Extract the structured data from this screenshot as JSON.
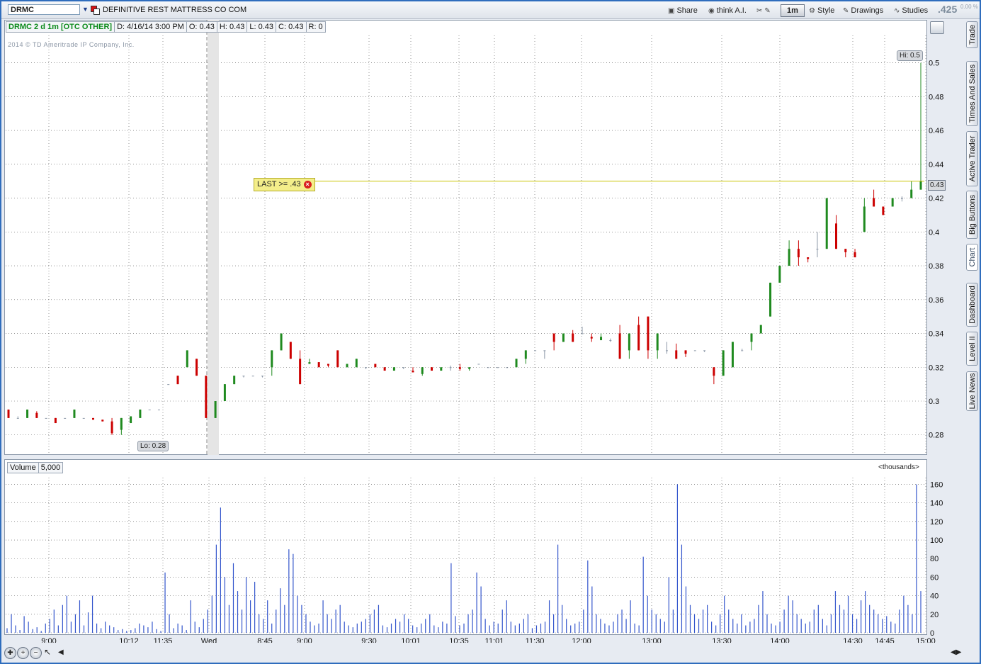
{
  "toolbar": {
    "symbol": "DRMC",
    "description": "DEFINITIVE REST MATTRESS CO COM",
    "share_label": "Share",
    "thinkai_label": "think A.I.",
    "aggregation_label": "1m",
    "style_label": "Style",
    "drawings_label": "Drawings",
    "studies_label": "Studies",
    "last_price": ".425",
    "percent_change": "0.00 %"
  },
  "info_bar": {
    "title": "DRMC 2 d 1m [OTC OTHER]",
    "date": "D: 4/16/14 3:00 PM",
    "open": "O: 0.43",
    "high": "H: 0.43",
    "low": "L: 0.43",
    "close": "C: 0.43",
    "range": "R: 0"
  },
  "copyright": "2014 © TD Ameritrade IP Company, Inc.",
  "alert": {
    "label": "LAST >= .43",
    "level": 0.43
  },
  "hi_label": "Hi: 0.5",
  "lo_label": "Lo: 0.28",
  "current_price_tag": "0.43",
  "volume_panel": {
    "label": "Volume",
    "value": "5,000",
    "units": "<thousands>"
  },
  "side_tabs": [
    "Trade",
    "Times And Sales",
    "Active Trader",
    "Big Buttons",
    "Chart",
    "Dashboard",
    "Level II",
    "Live News"
  ],
  "colors": {
    "up": "#1f8a1f",
    "down": "#cc0000",
    "flat": "#8a96a6",
    "volume": "#3355cc",
    "alert_line": "#c8c200",
    "alert_fill": "#f4ee8a"
  },
  "chart_data": [
    {
      "type": "candlestick",
      "title": "DRMC 2 d 1m [OTC OTHER]",
      "y_ticks": [
        0.28,
        0.3,
        0.32,
        0.34,
        0.36,
        0.38,
        0.4,
        0.42,
        0.44,
        0.46,
        0.48,
        0.5
      ],
      "y_tick_labels": [
        "0.28",
        "0.3",
        "0.32",
        "0.34",
        "0.36",
        "0.38",
        "0.4",
        "0.42",
        "0.44",
        "0.46",
        "0.48",
        "0.5"
      ],
      "ylim": [
        0.269,
        0.517
      ],
      "x_ticks": [
        "9:00",
        "10:12",
        "11:35",
        "Wed",
        "8:45",
        "9:00",
        "9:30",
        "10:01",
        "10:35",
        "11:01",
        "11:30",
        "12:00",
        "13:00",
        "13:30",
        "14:00",
        "14:30",
        "14:45",
        "15:00"
      ],
      "grid": true,
      "ohlc": [
        {
          "o": 0.295,
          "h": 0.295,
          "l": 0.29,
          "c": 0.29
        },
        {
          "o": 0.29,
          "h": 0.291,
          "l": 0.29,
          "c": 0.29
        },
        {
          "o": 0.29,
          "h": 0.295,
          "l": 0.29,
          "c": 0.295
        },
        {
          "o": 0.293,
          "h": 0.294,
          "l": 0.29,
          "c": 0.29
        },
        {
          "o": 0.29,
          "h": 0.29,
          "l": 0.29,
          "c": 0.29
        },
        {
          "o": 0.29,
          "h": 0.29,
          "l": 0.287,
          "c": 0.287
        },
        {
          "o": 0.29,
          "h": 0.29,
          "l": 0.29,
          "c": 0.29
        },
        {
          "o": 0.29,
          "h": 0.295,
          "l": 0.29,
          "c": 0.295
        },
        {
          "o": 0.29,
          "h": 0.29,
          "l": 0.29,
          "c": 0.29
        },
        {
          "o": 0.29,
          "h": 0.29,
          "l": 0.289,
          "c": 0.289
        },
        {
          "o": 0.289,
          "h": 0.289,
          "l": 0.288,
          "c": 0.288
        },
        {
          "o": 0.288,
          "h": 0.29,
          "l": 0.28,
          "c": 0.281
        },
        {
          "o": 0.283,
          "h": 0.29,
          "l": 0.28,
          "c": 0.29
        },
        {
          "o": 0.287,
          "h": 0.291,
          "l": 0.287,
          "c": 0.291
        },
        {
          "o": 0.29,
          "h": 0.295,
          "l": 0.29,
          "c": 0.295
        },
        {
          "o": 0.295,
          "h": 0.295,
          "l": 0.295,
          "c": 0.295
        },
        {
          "o": 0.295,
          "h": 0.295,
          "l": 0.295,
          "c": 0.295
        },
        {
          "o": 0.31,
          "h": 0.31,
          "l": 0.31,
          "c": 0.31
        },
        {
          "o": 0.315,
          "h": 0.315,
          "l": 0.31,
          "c": 0.31
        },
        {
          "o": 0.32,
          "h": 0.33,
          "l": 0.32,
          "c": 0.33
        },
        {
          "o": 0.325,
          "h": 0.325,
          "l": 0.315,
          "c": 0.315
        },
        {
          "o": 0.315,
          "h": 0.315,
          "l": 0.29,
          "c": 0.29
        },
        {
          "o": 0.29,
          "h": 0.3,
          "l": 0.29,
          "c": 0.3
        },
        {
          "o": 0.3,
          "h": 0.31,
          "l": 0.3,
          "c": 0.31
        },
        {
          "o": 0.31,
          "h": 0.315,
          "l": 0.31,
          "c": 0.315
        },
        {
          "o": 0.315,
          "h": 0.315,
          "l": 0.314,
          "c": 0.315
        },
        {
          "o": 0.315,
          "h": 0.315,
          "l": 0.315,
          "c": 0.315
        },
        {
          "o": 0.315,
          "h": 0.315,
          "l": 0.314,
          "c": 0.315
        },
        {
          "o": 0.32,
          "h": 0.33,
          "l": 0.315,
          "c": 0.33
        },
        {
          "o": 0.33,
          "h": 0.34,
          "l": 0.33,
          "c": 0.34
        },
        {
          "o": 0.335,
          "h": 0.335,
          "l": 0.325,
          "c": 0.325
        },
        {
          "o": 0.325,
          "h": 0.33,
          "l": 0.31,
          "c": 0.31
        },
        {
          "o": 0.322,
          "h": 0.325,
          "l": 0.322,
          "c": 0.323
        },
        {
          "o": 0.323,
          "h": 0.323,
          "l": 0.32,
          "c": 0.32
        },
        {
          "o": 0.322,
          "h": 0.322,
          "l": 0.32,
          "c": 0.321
        },
        {
          "o": 0.33,
          "h": 0.33,
          "l": 0.32,
          "c": 0.32
        },
        {
          "o": 0.32,
          "h": 0.322,
          "l": 0.32,
          "c": 0.322
        },
        {
          "o": 0.32,
          "h": 0.325,
          "l": 0.32,
          "c": 0.325
        },
        {
          "o": 0.32,
          "h": 0.32,
          "l": 0.319,
          "c": 0.32
        },
        {
          "o": 0.322,
          "h": 0.322,
          "l": 0.32,
          "c": 0.32
        },
        {
          "o": 0.32,
          "h": 0.32,
          "l": 0.318,
          "c": 0.318
        },
        {
          "o": 0.318,
          "h": 0.32,
          "l": 0.318,
          "c": 0.32
        },
        {
          "o": 0.32,
          "h": 0.32,
          "l": 0.319,
          "c": 0.32
        },
        {
          "o": 0.318,
          "h": 0.32,
          "l": 0.317,
          "c": 0.317
        },
        {
          "o": 0.316,
          "h": 0.32,
          "l": 0.315,
          "c": 0.32
        },
        {
          "o": 0.32,
          "h": 0.32,
          "l": 0.318,
          "c": 0.318
        },
        {
          "o": 0.318,
          "h": 0.32,
          "l": 0.318,
          "c": 0.32
        },
        {
          "o": 0.32,
          "h": 0.321,
          "l": 0.318,
          "c": 0.32
        },
        {
          "o": 0.32,
          "h": 0.322,
          "l": 0.318,
          "c": 0.319
        },
        {
          "o": 0.319,
          "h": 0.32,
          "l": 0.318,
          "c": 0.32
        },
        {
          "o": 0.322,
          "h": 0.322,
          "l": 0.322,
          "c": 0.322
        },
        {
          "o": 0.32,
          "h": 0.32,
          "l": 0.32,
          "c": 0.32
        },
        {
          "o": 0.32,
          "h": 0.32,
          "l": 0.32,
          "c": 0.32
        },
        {
          "o": 0.32,
          "h": 0.32,
          "l": 0.32,
          "c": 0.32
        },
        {
          "o": 0.32,
          "h": 0.325,
          "l": 0.32,
          "c": 0.325
        },
        {
          "o": 0.325,
          "h": 0.33,
          "l": 0.322,
          "c": 0.33
        },
        {
          "o": 0.33,
          "h": 0.33,
          "l": 0.33,
          "c": 0.33
        },
        {
          "o": 0.33,
          "h": 0.33,
          "l": 0.325,
          "c": 0.33
        },
        {
          "o": 0.34,
          "h": 0.34,
          "l": 0.33,
          "c": 0.335
        },
        {
          "o": 0.335,
          "h": 0.34,
          "l": 0.335,
          "c": 0.34
        },
        {
          "o": 0.34,
          "h": 0.342,
          "l": 0.335,
          "c": 0.335
        },
        {
          "o": 0.34,
          "h": 0.344,
          "l": 0.34,
          "c": 0.34
        },
        {
          "o": 0.338,
          "h": 0.34,
          "l": 0.335,
          "c": 0.337
        },
        {
          "o": 0.336,
          "h": 0.34,
          "l": 0.336,
          "c": 0.338
        },
        {
          "o": 0.336,
          "h": 0.337,
          "l": 0.335,
          "c": 0.336
        },
        {
          "o": 0.34,
          "h": 0.345,
          "l": 0.325,
          "c": 0.325
        },
        {
          "o": 0.33,
          "h": 0.34,
          "l": 0.325,
          "c": 0.34
        },
        {
          "o": 0.345,
          "h": 0.35,
          "l": 0.33,
          "c": 0.33
        },
        {
          "o": 0.35,
          "h": 0.35,
          "l": 0.325,
          "c": 0.33
        },
        {
          "o": 0.33,
          "h": 0.34,
          "l": 0.325,
          "c": 0.34
        },
        {
          "o": 0.33,
          "h": 0.335,
          "l": 0.328,
          "c": 0.33
        },
        {
          "o": 0.33,
          "h": 0.334,
          "l": 0.325,
          "c": 0.325
        },
        {
          "o": 0.33,
          "h": 0.33,
          "l": 0.326,
          "c": 0.328
        },
        {
          "o": 0.33,
          "h": 0.33,
          "l": 0.33,
          "c": 0.33
        },
        {
          "o": 0.33,
          "h": 0.33,
          "l": 0.329,
          "c": 0.33
        },
        {
          "o": 0.32,
          "h": 0.32,
          "l": 0.31,
          "c": 0.315
        },
        {
          "o": 0.315,
          "h": 0.33,
          "l": 0.315,
          "c": 0.33
        },
        {
          "o": 0.32,
          "h": 0.335,
          "l": 0.32,
          "c": 0.335
        },
        {
          "o": 0.33,
          "h": 0.331,
          "l": 0.33,
          "c": 0.33
        },
        {
          "o": 0.335,
          "h": 0.34,
          "l": 0.33,
          "c": 0.34
        },
        {
          "o": 0.34,
          "h": 0.345,
          "l": 0.34,
          "c": 0.345
        },
        {
          "o": 0.35,
          "h": 0.37,
          "l": 0.35,
          "c": 0.37
        },
        {
          "o": 0.37,
          "h": 0.38,
          "l": 0.37,
          "c": 0.38
        },
        {
          "o": 0.38,
          "h": 0.395,
          "l": 0.38,
          "c": 0.39
        },
        {
          "o": 0.39,
          "h": 0.395,
          "l": 0.38,
          "c": 0.385
        },
        {
          "o": 0.385,
          "h": 0.385,
          "l": 0.382,
          "c": 0.384
        },
        {
          "o": 0.39,
          "h": 0.4,
          "l": 0.385,
          "c": 0.39
        },
        {
          "o": 0.39,
          "h": 0.42,
          "l": 0.39,
          "c": 0.42
        },
        {
          "o": 0.405,
          "h": 0.41,
          "l": 0.39,
          "c": 0.39
        },
        {
          "o": 0.39,
          "h": 0.39,
          "l": 0.385,
          "c": 0.388
        },
        {
          "o": 0.388,
          "h": 0.39,
          "l": 0.385,
          "c": 0.385
        },
        {
          "o": 0.4,
          "h": 0.42,
          "l": 0.4,
          "c": 0.415
        },
        {
          "o": 0.42,
          "h": 0.425,
          "l": 0.415,
          "c": 0.415
        },
        {
          "o": 0.415,
          "h": 0.415,
          "l": 0.41,
          "c": 0.41
        },
        {
          "o": 0.415,
          "h": 0.42,
          "l": 0.415,
          "c": 0.42
        },
        {
          "o": 0.42,
          "h": 0.421,
          "l": 0.418,
          "c": 0.42
        },
        {
          "o": 0.42,
          "h": 0.43,
          "l": 0.42,
          "c": 0.425
        },
        {
          "o": 0.425,
          "h": 0.5,
          "l": 0.425,
          "c": 0.43
        }
      ]
    },
    {
      "type": "bar",
      "title": "Volume",
      "ylabel": "<thousands>",
      "y_ticks": [
        0,
        20,
        40,
        60,
        80,
        100,
        120,
        140,
        160
      ],
      "ylim": [
        0,
        168
      ],
      "values": [
        5,
        20,
        8,
        3,
        18,
        12,
        4,
        6,
        2,
        10,
        15,
        25,
        8,
        30,
        40,
        12,
        20,
        35,
        8,
        22,
        40,
        10,
        5,
        12,
        8,
        6,
        3,
        4,
        2,
        3,
        5,
        10,
        8,
        6,
        12,
        4,
        2,
        65,
        20,
        5,
        10,
        8,
        3,
        35,
        12,
        6,
        15,
        25,
        40,
        95,
        135,
        60,
        30,
        75,
        45,
        25,
        60,
        35,
        55,
        20,
        15,
        35,
        10,
        25,
        48,
        30,
        90,
        85,
        40,
        30,
        20,
        12,
        8,
        10,
        35,
        20,
        15,
        25,
        30,
        12,
        8,
        6,
        10,
        12,
        15,
        20,
        25,
        30,
        8,
        6,
        10,
        15,
        12,
        20,
        15,
        8,
        6,
        10,
        15,
        20,
        8,
        6,
        12,
        10,
        75,
        18,
        8,
        10,
        20,
        25,
        65,
        50,
        15,
        8,
        12,
        10,
        25,
        35,
        12,
        8,
        10,
        15,
        20,
        5,
        8,
        10,
        12,
        35,
        20,
        95,
        30,
        15,
        8,
        10,
        12,
        25,
        78,
        50,
        20,
        15,
        10,
        8,
        12,
        20,
        25,
        15,
        35,
        10,
        8,
        82,
        40,
        25,
        20,
        15,
        12,
        60,
        25,
        160,
        95,
        50,
        30,
        20,
        15,
        25,
        30,
        12,
        8,
        20,
        40,
        25,
        15,
        10,
        20,
        8,
        12,
        15,
        30,
        45,
        20,
        10,
        8,
        12,
        25,
        40,
        35,
        20,
        15,
        10,
        12,
        25,
        30,
        15,
        8,
        20,
        45,
        30,
        25,
        40,
        20,
        15,
        35,
        45,
        30,
        25,
        20,
        15,
        18,
        12,
        10,
        25,
        40,
        30,
        20,
        160,
        45
      ]
    }
  ]
}
